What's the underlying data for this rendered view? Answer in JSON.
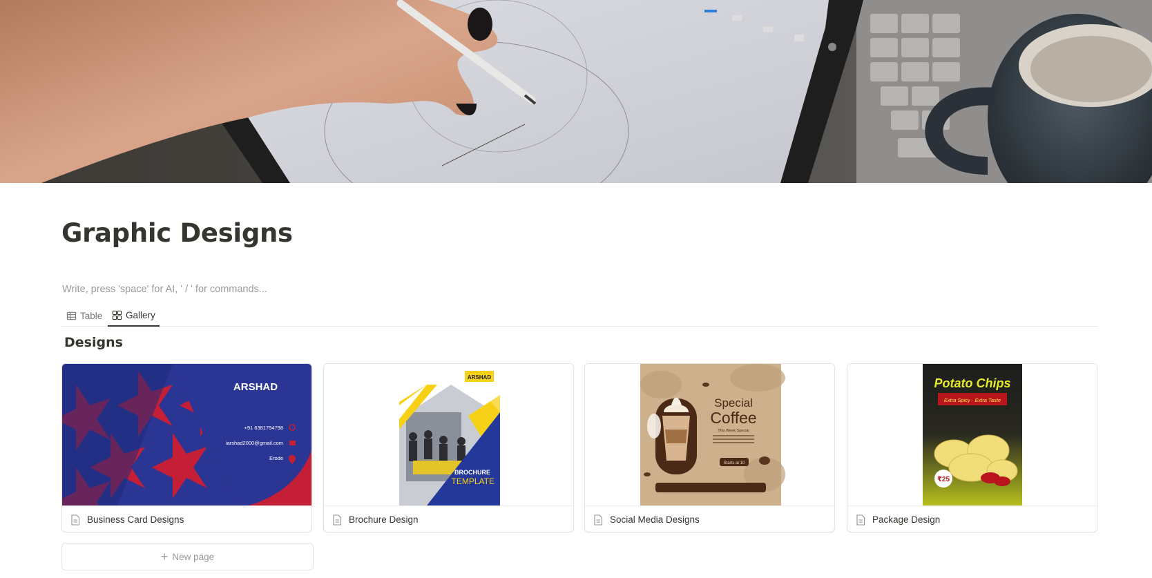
{
  "page": {
    "title": "Graphic Designs",
    "placeholder": "Write, press 'space' for AI, ' / ' for commands..."
  },
  "cover": {
    "icon": "cover-image-hand-drawing-on-tablet"
  },
  "view_tabs": [
    {
      "label": "Table",
      "icon": "table-icon",
      "active": false
    },
    {
      "label": "Gallery",
      "icon": "gallery-icon",
      "active": true
    }
  ],
  "database": {
    "title": "Designs",
    "cards": [
      {
        "title": "Business Card Designs",
        "icon": "page-icon",
        "preview": {
          "name": "ARSHAD",
          "phone": "+91 6381794798",
          "email": "iarshad2000@gmail.com",
          "location": "Erode"
        }
      },
      {
        "title": "Brochure Design",
        "icon": "page-icon",
        "preview": {
          "badge": "ARSHAD",
          "line1": "BROCHURE",
          "line2": "TEMPLATE"
        }
      },
      {
        "title": "Social Media Designs",
        "icon": "page-icon",
        "preview": {
          "line1": "Special",
          "line2": "Coffee",
          "line3": "This Week Special",
          "button": "Starts at 10"
        }
      },
      {
        "title": "Package Design",
        "icon": "page-icon",
        "preview": {
          "title": "Potato Chips",
          "tagline": "Extra Spicy · Extra Taste",
          "price": "₹25"
        }
      }
    ],
    "new_page_label": "New page"
  },
  "colors": {
    "text": "#37352f",
    "muted": "#9b9a97",
    "card_border": "#e3e2e0",
    "business_card_blue": "#2b3593",
    "business_card_red": "#c41f36",
    "brochure_yellow": "#f7d117",
    "coffee_tan": "#cdb08c",
    "chips_green": "#b6bf1e"
  }
}
